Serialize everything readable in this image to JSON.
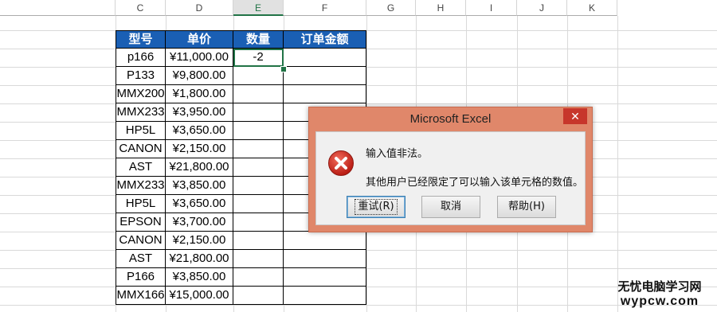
{
  "columns": [
    "C",
    "D",
    "E",
    "F",
    "G",
    "H",
    "I",
    "J",
    "K"
  ],
  "selected_column": "E",
  "table": {
    "headers": [
      "型号",
      "单价",
      "数量",
      "订单金额"
    ],
    "rows": [
      [
        "p166",
        "¥11,000.00",
        "-2",
        ""
      ],
      [
        "P133",
        "¥9,800.00",
        "",
        ""
      ],
      [
        "MMX200",
        "¥1,800.00",
        "",
        ""
      ],
      [
        "MMX233",
        "¥3,950.00",
        "",
        ""
      ],
      [
        "HP5L",
        "¥3,650.00",
        "",
        ""
      ],
      [
        "CANON",
        "¥2,150.00",
        "",
        ""
      ],
      [
        "AST",
        "¥21,800.00",
        "",
        ""
      ],
      [
        "MMX233",
        "¥3,850.00",
        "",
        ""
      ],
      [
        "HP5L",
        "¥3,650.00",
        "",
        ""
      ],
      [
        "EPSON",
        "¥3,700.00",
        "",
        ""
      ],
      [
        "CANON",
        "¥2,150.00",
        "",
        ""
      ],
      [
        "AST",
        "¥21,800.00",
        "",
        ""
      ],
      [
        "P166",
        "¥3,850.00",
        "",
        ""
      ],
      [
        "MMX166",
        "¥15,000.00",
        "",
        ""
      ]
    ]
  },
  "dialog": {
    "title": "Microsoft Excel",
    "close": "✕",
    "message_1": "输入值非法。",
    "message_2": "其他用户已经限定了可以输入该单元格的数值。",
    "buttons": [
      "重试(R)",
      "取消",
      "帮助(H)"
    ]
  },
  "watermark": {
    "top": "无忧电脑学习网",
    "bottom": "wypcw.com"
  },
  "colors": {
    "header_bg": "#1a5fb4",
    "dialog_frame": "#e0876a",
    "close_bg": "#c7362b",
    "active": "#217346"
  }
}
